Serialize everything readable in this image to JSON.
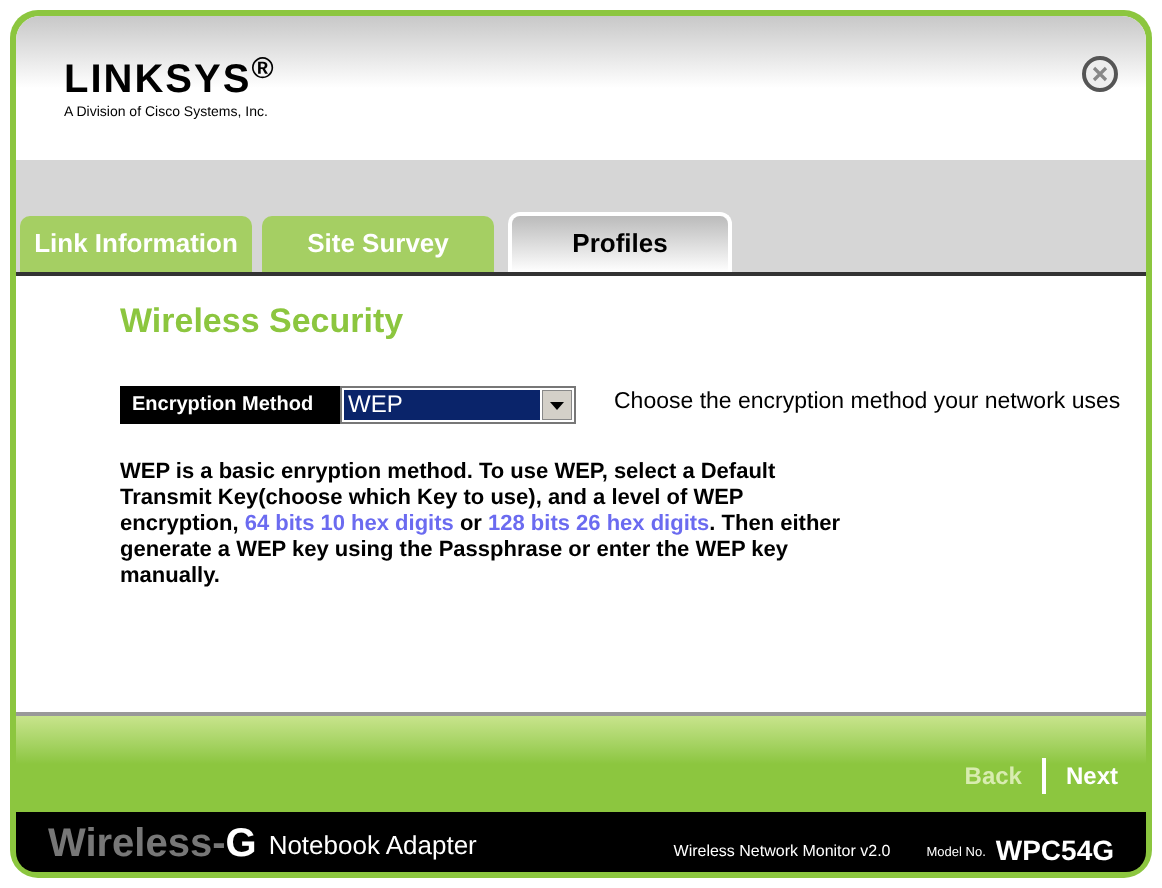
{
  "header": {
    "logo": "LINKSYS$^{®}$",
    "tagline": "A Division of Cisco Systems, Inc."
  },
  "tabs": [
    {
      "label": "Link Information",
      "selected": false
    },
    {
      "label": "Site Survey",
      "selected": false
    },
    {
      "label": "Profiles",
      "selected": true
    }
  ],
  "section_title": "Wireless Security",
  "encryption": {
    "label": "Encryption Method",
    "value": "WEP",
    "hint": "Choose the encryption method your network uses"
  },
  "description": [
    {
      "kind": "text",
      "text": "WEP is a basic enryption method. To use WEP, select a Default Transmit Key(choose which Key to use), and a level of WEP encryption, "
    },
    {
      "kind": "link",
      "text": "64 bits 10 hex digits"
    },
    {
      "kind": "text",
      "text": " or "
    },
    {
      "kind": "link",
      "text": "128 bits 26 hex digits"
    },
    {
      "kind": "text",
      "text": ". Then either generate a WEP key using the Passphrase or enter the WEP key manually."
    }
  ],
  "nav": [
    {
      "label": "Back",
      "disabled": true
    },
    {
      "label": "Next",
      "disabled": false
    }
  ],
  "footer": {
    "product_brand": "Wireless-",
    "product_letter": "G",
    "product_name": "Notebook Adapter",
    "monitor": "Wireless Network Monitor v2.0",
    "model_label": "Model No.",
    "model": "WPC54G"
  }
}
